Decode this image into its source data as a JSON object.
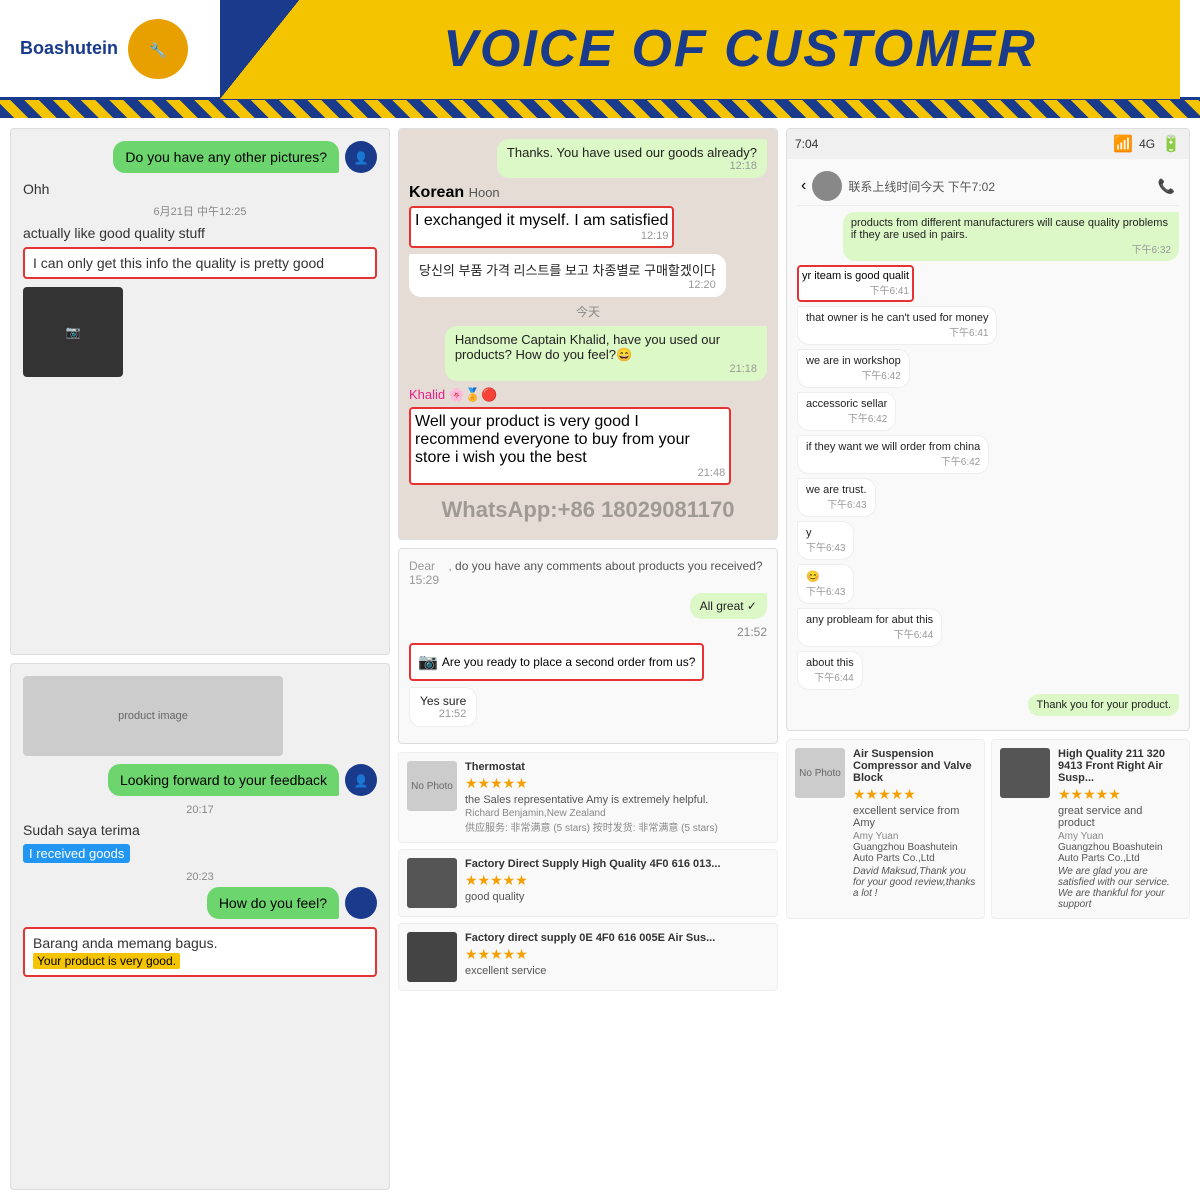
{
  "header": {
    "logo_text": "Boashutein",
    "title": "VOICE OF CUSTOMER",
    "whatsapp": "WhatsApp:+86 18029081170"
  },
  "left_top_chat": {
    "bubble_text": "Do you have any other pictures?",
    "text1": "Ohh",
    "timestamp1": "6月21日 中午12:25",
    "text2": "actually like good quality stuff",
    "highlighted_text": "I can only get this info the quality is pretty good"
  },
  "left_bottom_chat": {
    "image_placeholder": "product image",
    "bubble_text": "Looking forward to your feedback",
    "text1": "Sudah saya terima",
    "text2": "I received goods",
    "timestamp1": "20:17",
    "timestamp2": "20:23",
    "bubble2": "How do you feel?",
    "highlighted2": "Barang anda memang bagus.",
    "highlighted2_sub": "Your product is very good."
  },
  "mid_top_chat": {
    "msg1": "Thanks. You have used our goods already?",
    "msg1_time": "12:18",
    "speaker": "Korean",
    "speaker_sub": "Hoon",
    "msg2": "I exchanged it myself. I am satisfied",
    "msg2_time": "12:19",
    "msg3": "당신의 부품 가격 리스트를 보고 차종별로 구매할겠이다",
    "msg3_time": "12:20",
    "date_divider": "今天",
    "msg4": "Handsome Captain Khalid, have you used our products? How do you feel?😄",
    "msg4_time": "21:18",
    "speaker2": "Khalid 🌸🏅🔴",
    "msg5": "Well your product is very good I recommend everyone to buy from your store i wish you the best",
    "msg5_time": "21:48"
  },
  "mid_second_order": {
    "dear_msg": "do you have any comments about products you received?",
    "dear_time": "15:29",
    "msg1": "All great ✓",
    "reply_msg": "Are you ready to place a second order from us?",
    "reply_time": "21:52",
    "highlighted": "Are you ready to place a second order from us?",
    "yes_msg": "Yes sure",
    "yes_time": "21:52"
  },
  "right_mobile_chat": {
    "time": "7:04",
    "status": "4G",
    "msg1": "products from different manufacturers will cause quality problems if they are used in pairs.",
    "msg1_time": "下午6:32",
    "msg2": "yr iteam is good qualit",
    "msg2_time": "下午6:41",
    "msg3": "that owner is he can't used for money",
    "msg3_time": "下午6:41",
    "msg4": "we are in workshop",
    "msg4_time": "下午6:42",
    "msg5": "accessoric sellar",
    "msg5_time": "下午6:42",
    "msg6": "if they want we will order from china",
    "msg6_time": "下午6:42",
    "msg7": "we are trust.",
    "msg7_time": "下午6:43",
    "msg8": "y",
    "msg8_time": "下午6:43",
    "emoji": "😊",
    "emoji_time": "下午6:43",
    "msg9": "any probleam for abut this",
    "msg9_time": "下午6:44",
    "msg10": "about this",
    "msg10_time": "下午6:44",
    "msg11": "Thank you for your product."
  },
  "reviews": {
    "items": [
      {
        "product": "Thermostat",
        "stars": "★★★★★",
        "text": "the Sales representative Amy is extremely helpful.",
        "reviewer": "Richard Benjamin,New Zealand",
        "service_rating": "供应服务: 非常满意 (5 stars)   按时发货: 非常满意 (5 stars)"
      },
      {
        "product": "Air Suspension Compressor and Valve Block",
        "stars": "★★★★★",
        "text": "excellent service from Amy",
        "reviewer": "Amy Yuan",
        "company": "Guangzhou Boashutein Auto Parts Co.,Ltd",
        "reply": "David Maksud,Thank you for your good review,thanks a lot !"
      },
      {
        "product": "Factory Direct Supply High Quality 4F0 616 013...",
        "stars": "★★★★★",
        "text": "good quality"
      },
      {
        "product": "High Quality 211 320 9413 Front Right Air Susp...",
        "stars": "★★★★★",
        "text": "great service and product",
        "reviewer": "Amy Yuan",
        "company": "Guangzhou Boashutein Auto Parts Co.,Ltd",
        "reply": "We are glad you are satisfied with our service. We are thankful for your support"
      },
      {
        "product": "Factory direct supply 0E 4F0 616 005E Air Sus...",
        "stars": "★★★★★",
        "text": "excellent service"
      }
    ]
  }
}
